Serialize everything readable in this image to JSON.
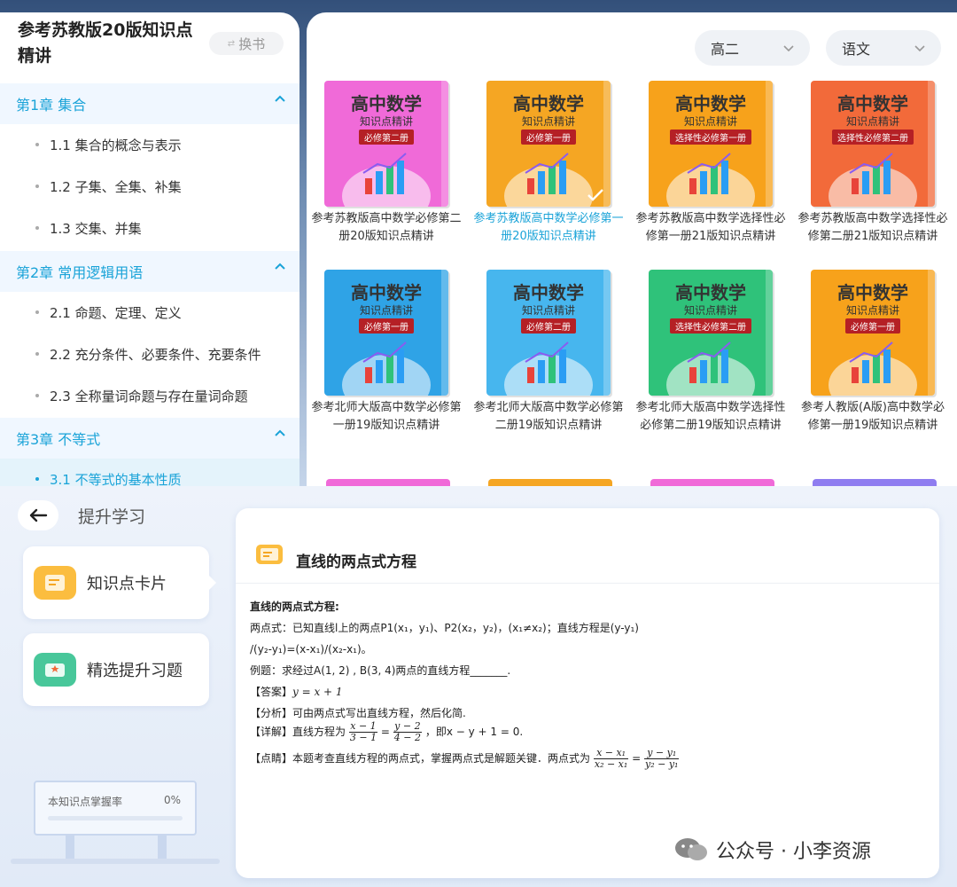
{
  "toc": {
    "title": "参考苏教版20版知识点精讲",
    "switch_label": "换书",
    "chapters": [
      {
        "label": "第1章 集合",
        "sections": [
          "1.1 集合的概念与表示",
          "1.2 子集、全集、补集",
          "1.3 交集、并集"
        ]
      },
      {
        "label": "第2章 常用逻辑用语",
        "sections": [
          "2.1 命题、定理、定义",
          "2.2 充分条件、必要条件、充要条件",
          "2.3 全称量词命题与存在量词命题"
        ]
      },
      {
        "label": "第3章 不等式",
        "sections": [
          "3.1 不等式的基本性质"
        ]
      }
    ]
  },
  "filters": {
    "grade": "高二",
    "subject": "语文"
  },
  "books": [
    {
      "cover_title": "高中数学",
      "cover_sub": "知识点精讲",
      "tag": "必修第二册",
      "name": "参考苏教版高中数学必修第二册20版知识点精讲",
      "color": "#f06ad8",
      "selected": false
    },
    {
      "cover_title": "高中数学",
      "cover_sub": "知识点精讲",
      "tag": "必修第一册",
      "name": "参考苏教版高中数学必修第一册20版知识点精讲",
      "color": "#f5a623",
      "selected": true
    },
    {
      "cover_title": "高中数学",
      "cover_sub": "知识点精讲",
      "tag": "选择性必修第一册",
      "name": "参考苏教版高中数学选择性必修第一册21版知识点精讲",
      "color": "#f7a21b",
      "selected": false
    },
    {
      "cover_title": "高中数学",
      "cover_sub": "知识点精讲",
      "tag": "选择性必修第二册",
      "name": "参考苏教版高中数学选择性必修第二册21版知识点精讲",
      "color": "#f26a3a",
      "selected": false
    },
    {
      "cover_title": "高中数学",
      "cover_sub": "知识点精讲",
      "tag": "必修第一册",
      "name": "参考北师大版高中数学必修第一册19版知识点精讲",
      "color": "#2fa3e6",
      "selected": false
    },
    {
      "cover_title": "高中数学",
      "cover_sub": "知识点精讲",
      "tag": "必修第二册",
      "name": "参考北师大版高中数学必修第二册19版知识点精讲",
      "color": "#47b6ee",
      "selected": false
    },
    {
      "cover_title": "高中数学",
      "cover_sub": "知识点精讲",
      "tag": "选择性必修第二册",
      "name": "参考北师大版高中数学选择性必修第二册19版知识点精讲",
      "color": "#2fc27a",
      "selected": false
    },
    {
      "cover_title": "高中数学",
      "cover_sub": "知识点精讲",
      "tag": "必修第一册",
      "name": "参考人教版(A版)高中数学必修第一册19版知识点精讲",
      "color": "#f7a21b",
      "selected": false
    }
  ],
  "study": {
    "back_icon": "arrow-left-icon",
    "title": "提升学习",
    "tile_cards": "知识点卡片",
    "tile_exercises": "精选提升习题",
    "mastery_label": "本知识点掌握率",
    "mastery_value": "0%",
    "mastery_fraction": 0
  },
  "card": {
    "title": "直线的两点式方程",
    "heading": "直线的两点式方程:",
    "line1": "两点式：已知直线l上的两点P1(x₁，y₁)、P2(x₂，y₂)，(x₁≠x₂)；直线方程是(y-y₁)",
    "line2": "/(y₂-y₁)=(x-x₁)/(x₂-x₁)。",
    "example": "例题：求经过A(1, 2) , B(3, 4)两点的直线方程_______.",
    "answer_tag": "【答案】",
    "answer": "y = x + 1",
    "analysis_tag": "【分析】",
    "analysis": "可由两点式写出直线方程，然后化简.",
    "detail_tag": "【详解】",
    "detail_pre": "直线方程为",
    "detail_frac1_num": "x − 1",
    "detail_frac1_den": "3 − 1",
    "detail_frac2_num": "y − 2",
    "detail_frac2_den": "4 − 2",
    "detail_post": "，即x − y + 1 = 0.",
    "note_tag": "【点睛】",
    "note": "本题考查直线方程的两点式，掌握两点式是解题关键．两点式为",
    "note_frac1_num": "x − x₁",
    "note_frac1_den": "x₂ − x₁",
    "note_frac2_num": "y − y₁",
    "note_frac2_den": "y₂ − y₁"
  },
  "watermark": "公众号 · 小李资源",
  "colors": {
    "accent": "#1aa3d8",
    "tag_red": "#b52025"
  }
}
